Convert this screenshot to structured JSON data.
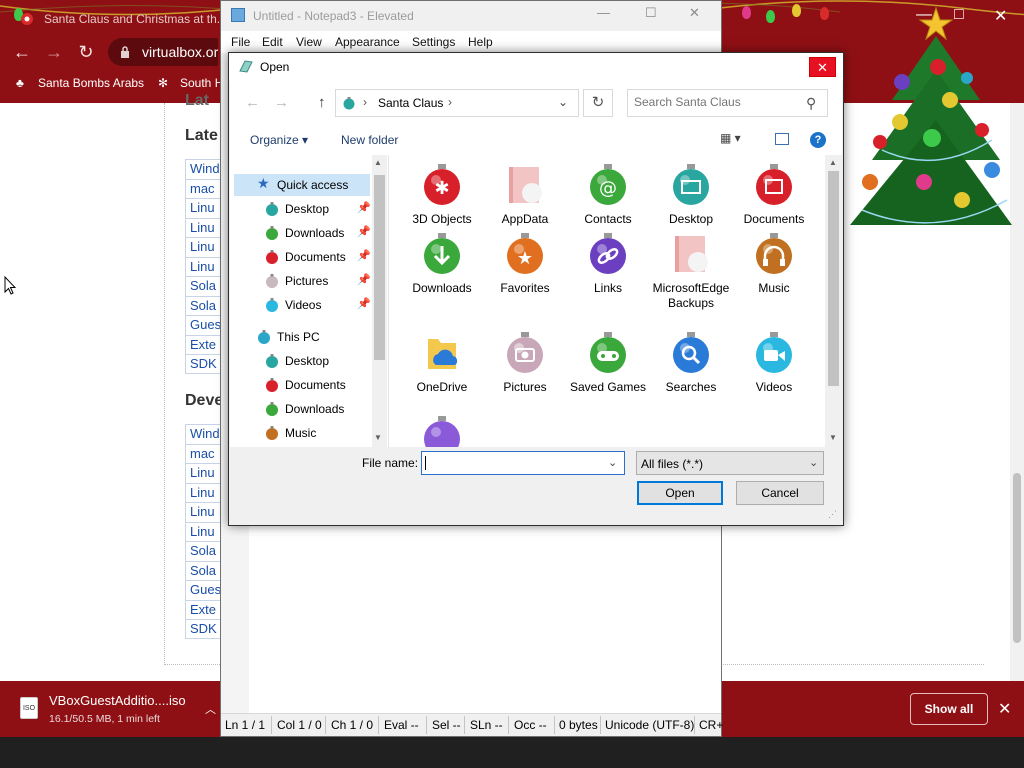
{
  "browser": {
    "tab_title": "Santa Claus and Christmas at th...",
    "url": "virtualbox.or",
    "bookmarks": [
      "Santa Bombs Arabs",
      "South H"
    ],
    "window_controls": [
      "—",
      "□",
      "✕"
    ]
  },
  "webpage": {
    "section_latest": "Late",
    "section_dev": "Deve",
    "latest_links": [
      "Wind",
      "mac",
      "Linu",
      "Linu",
      "Linu",
      "Linu",
      "Sola",
      "Sola",
      "Gues",
      "Exte",
      "SDK"
    ],
    "dev_links": [
      "Wind",
      "mac",
      "Linu",
      "Linu",
      "Linu",
      "Linu",
      "Sola",
      "Sola",
      "Gues",
      "Exte",
      "SDK"
    ],
    "partial_heading": "Lat"
  },
  "download_bar": {
    "file_name": "VBoxGuestAdditio....iso",
    "status": "16.1/50.5 MB, 1 min left",
    "file_type": "ISO",
    "show_all": "Show all"
  },
  "notepad": {
    "title": "Untitled - Notepad3 - Elevated",
    "menu": [
      "File",
      "Edit",
      "View",
      "Appearance",
      "Settings",
      "Help"
    ],
    "status": {
      "ln": "Ln  1 / 1",
      "col": "Col  1 / 0",
      "ch": "Ch  1 / 0",
      "eval": "Eval  --",
      "sel": "Sel  --",
      "sln": "SLn  --",
      "occ": "Occ  --",
      "bytes": "0 bytes",
      "encoding": "Unicode (UTF-8)",
      "eol": "CR+"
    }
  },
  "dialog": {
    "title": "Open",
    "breadcrumb": "Santa Claus",
    "search_placeholder": "Search Santa Claus",
    "organize": "Organize",
    "new_folder": "New folder",
    "nav": {
      "quick_access": "Quick access",
      "qa_items": [
        "Desktop",
        "Downloads",
        "Documents",
        "Pictures",
        "Videos"
      ],
      "this_pc": "This PC",
      "pc_items": [
        "Desktop",
        "Documents",
        "Downloads",
        "Music"
      ]
    },
    "items": [
      {
        "label": "3D Objects",
        "color": "#d8202a"
      },
      {
        "label": "AppData",
        "color": "#e8a0a0"
      },
      {
        "label": "Contacts",
        "color": "#3ba83b"
      },
      {
        "label": "Desktop",
        "color": "#2aa6a0"
      },
      {
        "label": "Documents",
        "color": "#d8202a"
      },
      {
        "label": "Downloads",
        "color": "#3ba83b"
      },
      {
        "label": "Favorites",
        "color": "#e07020"
      },
      {
        "label": "Links",
        "color": "#6b3fc0"
      },
      {
        "label": "MicrosoftEdgeBackups",
        "color": "#e8a0a0"
      },
      {
        "label": "Music",
        "color": "#c07020"
      },
      {
        "label": "OneDrive",
        "color": "#2a7ad8"
      },
      {
        "label": "Pictures",
        "color": "#c8a8b8"
      },
      {
        "label": "Saved Games",
        "color": "#3ba83b"
      },
      {
        "label": "Searches",
        "color": "#2a7ad8"
      },
      {
        "label": "Videos",
        "color": "#2ab8e0"
      },
      {
        "label": "",
        "color": "#8a5ad8"
      }
    ],
    "file_name_label": "File name:",
    "file_name_value": "",
    "filter": "All files (*.*)",
    "open": "Open",
    "cancel": "Cancel"
  }
}
